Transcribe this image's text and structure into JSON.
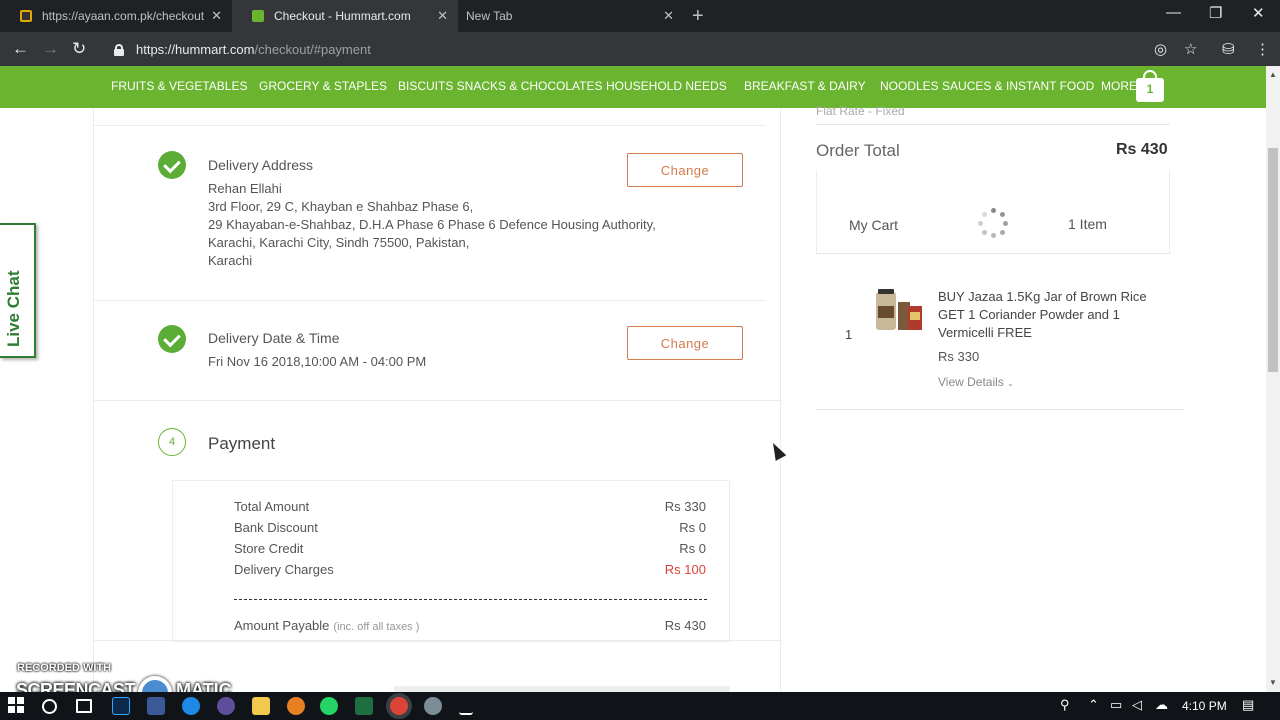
{
  "browser": {
    "tabs": [
      {
        "title": "https://ayaan.com.pk/checkout",
        "active": false
      },
      {
        "title": "Checkout - Hummart.com",
        "active": true
      },
      {
        "title": "New Tab",
        "active": false
      }
    ],
    "url_host": "https://hummart.com",
    "url_path": "/checkout/#payment"
  },
  "menu": {
    "items": [
      "FRUITS & VEGETABLES",
      "GROCERY & STAPLES",
      "BISCUITS SNACKS & CHOCOLATES",
      "HOUSEHOLD NEEDS",
      "BREAKFAST & DAIRY",
      "NOODLES SAUCES & INSTANT FOOD",
      "MORE"
    ],
    "cart_count": "1"
  },
  "delivery_address": {
    "title": "Delivery Address",
    "lines": [
      "Rehan Ellahi",
      "3rd Floor, 29 C, Khayban e Shahbaz Phase 6,",
      "29 Khayaban-e-Shahbaz, D.H.A Phase 6 Phase 6 Defence Housing Authority,",
      "Karachi, Karachi City, Sindh 75500, Pakistan,",
      "Karachi"
    ],
    "change_label": "Change"
  },
  "delivery_time": {
    "title": "Delivery Date & Time",
    "value": "Fri Nov 16 2018,10:00 AM - 04:00 PM",
    "change_label": "Change"
  },
  "payment": {
    "step": "4",
    "title": "Payment",
    "rows": [
      {
        "label": "Total Amount",
        "value": "Rs 330"
      },
      {
        "label": "Bank Discount",
        "value": "Rs 0"
      },
      {
        "label": "Store Credit",
        "value": "Rs 0"
      },
      {
        "label": "Delivery Charges",
        "value": "Rs 100"
      }
    ],
    "payable_label": "Amount Payable",
    "payable_note": "(inc. off all taxes )",
    "payable_value": "Rs 430",
    "accent_red": "#e0413a"
  },
  "summary": {
    "flat_rate": "Flat Rate - Fixed",
    "order_total_label": "Order Total",
    "order_total_value": "Rs 430",
    "my_cart": "My Cart",
    "item_count": "1 Item",
    "item": {
      "qty": "1",
      "name": "BUY Jazaa 1.5Kg Jar of Brown Rice GET 1 Coriander Powder and 1 Vermicelli FREE",
      "price": "Rs 330",
      "view_details": "View Details"
    }
  },
  "live_chat": "Live Chat",
  "watermark": {
    "line1": "RECORDED WITH",
    "line2": "SCREENCAST",
    "line3": "MATIC"
  },
  "taskbar": {
    "time": "4:10 PM"
  },
  "colors": {
    "brand_green": "#6bb42f",
    "change_orange": "#d27b4b"
  }
}
